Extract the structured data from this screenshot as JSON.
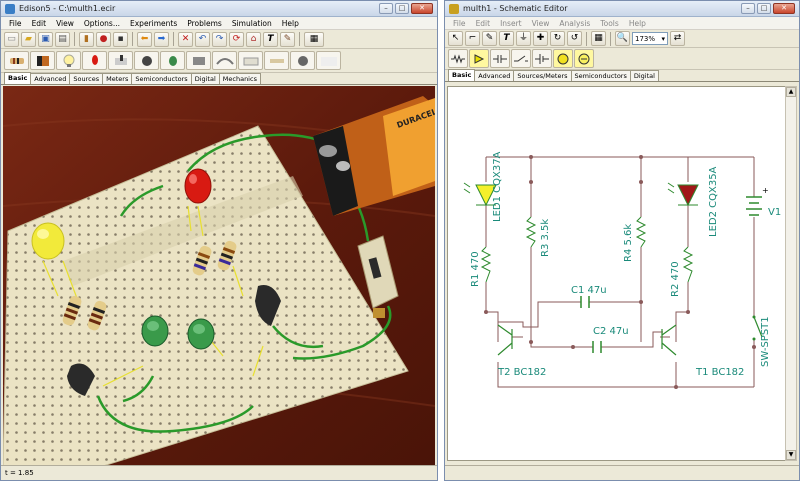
{
  "left_window": {
    "title": "Edison5 - C:\\multh1.ecir",
    "menu": [
      "File",
      "Edit",
      "View",
      "Options...",
      "Experiments",
      "Problems",
      "Simulation",
      "Help"
    ],
    "tabs": [
      "Basic",
      "Advanced",
      "Sources",
      "Meters",
      "Semiconductors",
      "Digital",
      "Mechanics"
    ],
    "active_tab": 0,
    "status_text": "t = 1.85",
    "battery_label": "DURACELL"
  },
  "right_window": {
    "title": "multh1 - Schematic Editor",
    "menu": [
      "File",
      "Edit",
      "Insert",
      "View",
      "Analysis",
      "Tools",
      "Help"
    ],
    "zoom_value": "173%",
    "tabs": [
      "Basic",
      "Advanced",
      "Sources/Meters",
      "Semiconductors",
      "Digital"
    ],
    "active_tab": 0
  },
  "schematic": {
    "labels": {
      "led1": "LED1 CQX37A",
      "r3": "R3 3.5k",
      "r4": "R4 5.6k",
      "led2": "LED2 CQX35A",
      "v1": "V1",
      "r1": "R1 470",
      "r2": "R2 470",
      "c1": "C1 47u",
      "c2": "C2 47u",
      "t2": "T2 BC182",
      "t1": "T1 BC182",
      "sw": "SW-SPST1",
      "plus": "+"
    },
    "colors": {
      "wire": "#8a5a5a",
      "label": "#1a8a7a",
      "led1_fill": "#f4f02a",
      "led2_fill": "#a01818",
      "component": "#2e8a2e"
    }
  },
  "scene_colors": {
    "table": "#6b1e0e",
    "breadboard": "#ece5c8",
    "wire": "#2a8a2a",
    "yellow_led": "#f2ea3a",
    "red_led": "#d81a12"
  }
}
